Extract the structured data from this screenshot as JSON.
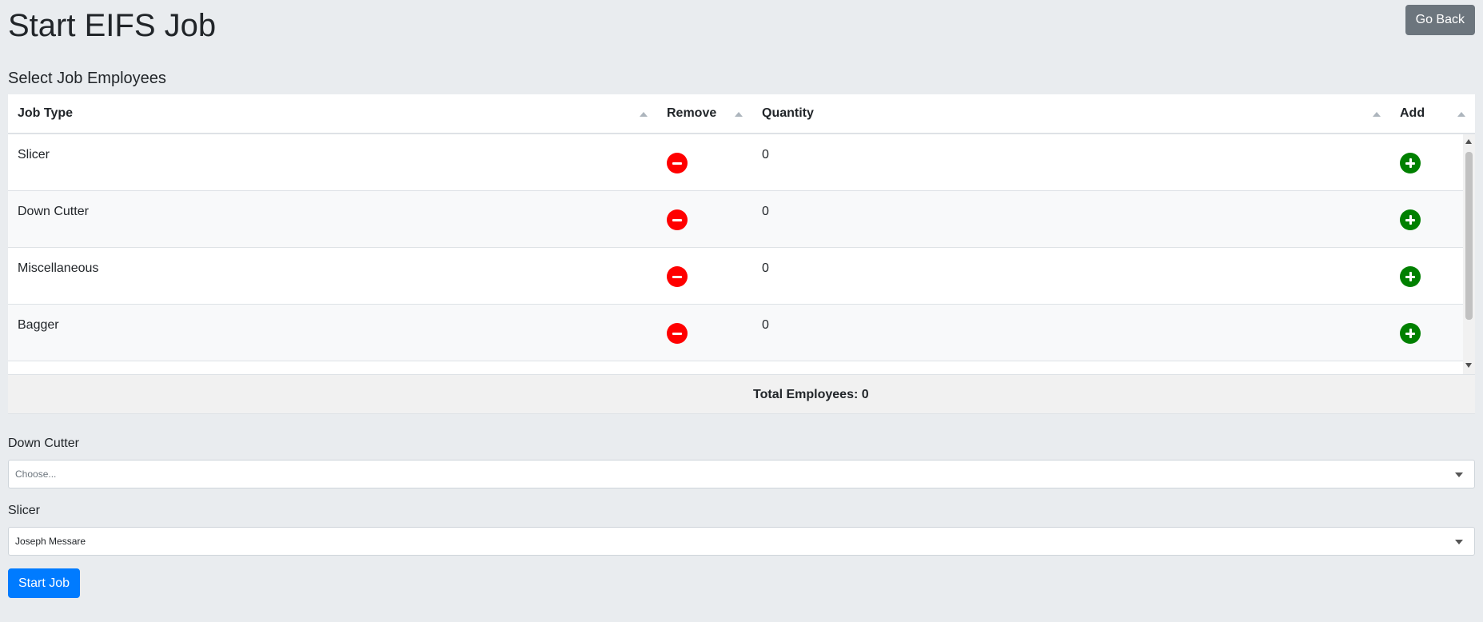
{
  "header": {
    "title": "Start EIFS Job",
    "go_back_label": "Go Back"
  },
  "employees_section": {
    "title": "Select Job Employees",
    "columns": [
      "Job Type",
      "Remove",
      "Quantity",
      "Add"
    ],
    "rows": [
      {
        "job_type": "Slicer",
        "quantity": "0"
      },
      {
        "job_type": "Down Cutter",
        "quantity": "0"
      },
      {
        "job_type": "Miscellaneous",
        "quantity": "0"
      },
      {
        "job_type": "Bagger",
        "quantity": "0"
      }
    ],
    "total_label": "Total Employees: 0"
  },
  "fields": [
    {
      "label": "Down Cutter",
      "value": "Choose...",
      "is_placeholder": true
    },
    {
      "label": "Slicer",
      "value": "Joseph Messare",
      "is_placeholder": false
    }
  ],
  "actions": {
    "start_label": "Start Job"
  },
  "colors": {
    "remove": "#ff0000",
    "add": "#008000",
    "primary": "#007bff",
    "secondary": "#6c757d"
  },
  "icons": {
    "remove": "minus-circle-icon",
    "add": "plus-circle-icon",
    "sort": "sort-up-icon",
    "select": "chevron-down-icon"
  }
}
